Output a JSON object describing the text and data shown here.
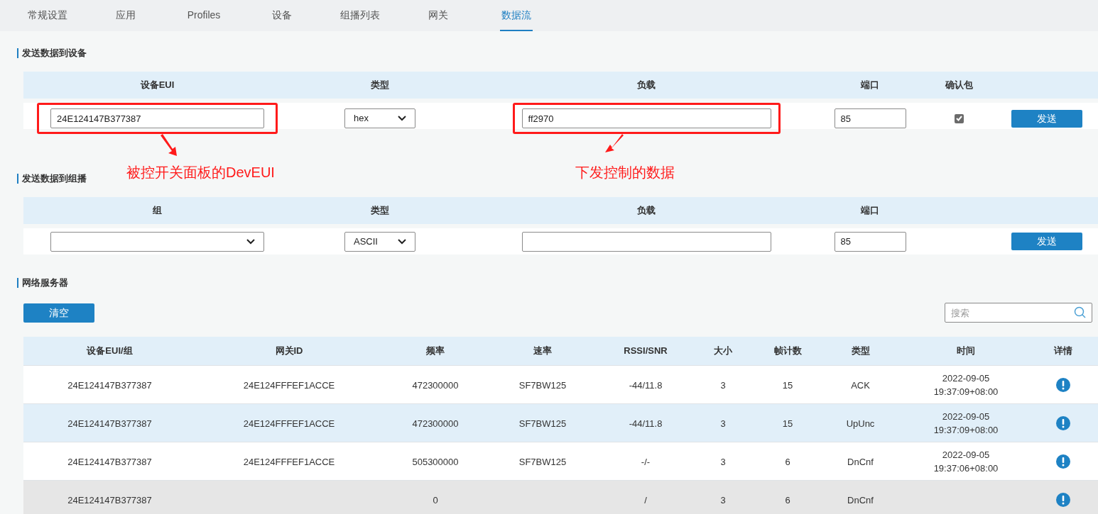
{
  "tabs": [
    {
      "label": "常规设置",
      "selected": false
    },
    {
      "label": "应用",
      "selected": false
    },
    {
      "label": "Profiles",
      "selected": false
    },
    {
      "label": "设备",
      "selected": false
    },
    {
      "label": "组播列表",
      "selected": false
    },
    {
      "label": "网关",
      "selected": false
    },
    {
      "label": "数据流",
      "selected": true
    }
  ],
  "send_to_device": {
    "title": "发送数据到设备",
    "columns": [
      "设备EUI",
      "类型",
      "负载",
      "端口",
      "确认包"
    ],
    "device_eui": "24E124147B377387",
    "type": "hex",
    "payload": "ff2970",
    "port": "85",
    "confirmed": true,
    "button": "发送"
  },
  "annotations": [
    {
      "text": "被控开关面板的DevEUI"
    },
    {
      "text": "下发控制的数据"
    }
  ],
  "send_to_multicast": {
    "title": "发送数据到组播",
    "columns": [
      "组",
      "类型",
      "负载",
      "端口"
    ],
    "type": "ASCII",
    "port": "85",
    "button": "发送"
  },
  "network_server": {
    "title": "网络服务器",
    "clear_button": "清空",
    "search": {
      "placeholder": "搜索"
    },
    "columns": [
      "设备EUI/组",
      "网关ID",
      "频率",
      "速率",
      "RSSI/SNR",
      "大小",
      "帧计数",
      "类型",
      "时间",
      "详情"
    ],
    "rows": [
      {
        "selected": false,
        "disabled": false,
        "cells": [
          "24E124147B377387",
          "24E124FFFEF1ACCE",
          "472300000",
          "SF7BW125",
          "-44/11.8",
          "3",
          "15",
          "ACK"
        ],
        "date": "2022-09-05",
        "time": "19:37:09+08:00"
      },
      {
        "selected": true,
        "disabled": false,
        "cells": [
          "24E124147B377387",
          "24E124FFFEF1ACCE",
          "472300000",
          "SF7BW125",
          "-44/11.8",
          "3",
          "15",
          "UpUnc"
        ],
        "date": "2022-09-05",
        "time": "19:37:09+08:00"
      },
      {
        "selected": false,
        "disabled": false,
        "cells": [
          "24E124147B377387",
          "24E124FFFEF1ACCE",
          "505300000",
          "SF7BW125",
          "-/-",
          "3",
          "6",
          "DnCnf"
        ],
        "date": "2022-09-05",
        "time": "19:37:06+08:00"
      },
      {
        "selected": false,
        "disabled": true,
        "cells": [
          "24E124147B377387",
          "",
          "0",
          "",
          "/",
          "3",
          "6",
          "DnCnf"
        ],
        "date": "",
        "time": ""
      }
    ]
  }
}
